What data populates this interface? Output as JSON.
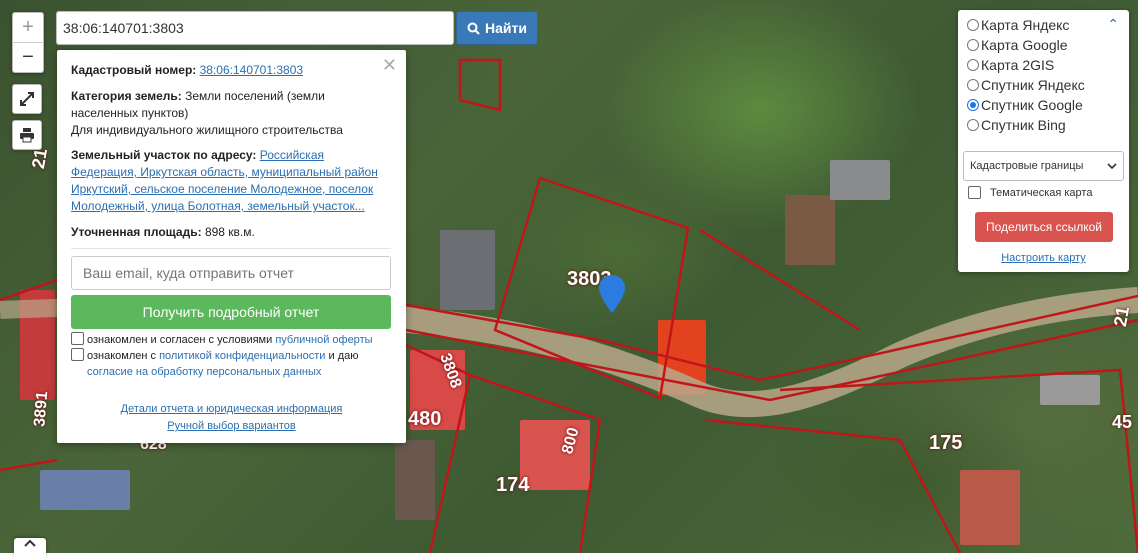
{
  "search": {
    "value": "38:06:140701:3803",
    "button_label": "Найти"
  },
  "map": {
    "parcel_labels": [
      "3803",
      "3808",
      "480",
      "800",
      "174",
      "175",
      "628",
      "3891",
      "21",
      "21",
      "45"
    ],
    "parcel_color": "#c0161a",
    "marker_color": "#2b7be0"
  },
  "popup": {
    "cadastral_label": "Кадастровый номер:",
    "cadastral_value": "38:06:140701:3803",
    "category_label": "Категория земель:",
    "category_value": "Земли поселений (земли населенных пунктов)",
    "usage": "Для индивидуального жилищного строительства",
    "address_label": "Земельный участок по адресу:",
    "address_value": "Российская Федерация, Иркутская область, муниципальный район Иркутский, сельское поселение Молодежное, поселок Молодежный, улица Болотная, земельный участок...",
    "area_label": "Уточненная площадь:",
    "area_value": "898 кв.м.",
    "email_placeholder": "Ваш email, куда отправить отчет",
    "report_button": "Получить подробный отчет",
    "check1_text": "ознакомлен и согласен с условиями",
    "check1_link": "публичной оферты",
    "check2_text": "ознакомлен с",
    "check2_link": "политикой конфиденциальности",
    "check2_text2": "и даю",
    "check2_link2": "согласие на обработку персональных данных",
    "details_link": "Детали отчета и юридическая информация",
    "manual_link": "Ручной выбор вариантов"
  },
  "layers": {
    "options": [
      {
        "label": "Карта Яндекс",
        "selected": false
      },
      {
        "label": "Карта Google",
        "selected": false
      },
      {
        "label": "Карта 2GIS",
        "selected": false
      },
      {
        "label": "Спутник Яндекс",
        "selected": false
      },
      {
        "label": "Спутник Google",
        "selected": true
      },
      {
        "label": "Спутник Bing",
        "selected": false
      }
    ],
    "overlay_select": "Кадастровые границы",
    "thematic_label": "Тематическая карта",
    "share_button": "Поделиться ссылкой",
    "setup_link": "Настроить карту"
  }
}
